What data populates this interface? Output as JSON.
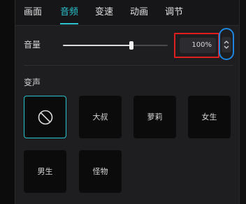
{
  "tabs": [
    {
      "label": "画面"
    },
    {
      "label": "音频",
      "active": true
    },
    {
      "label": "变速"
    },
    {
      "label": "动画"
    },
    {
      "label": "调节"
    }
  ],
  "volume": {
    "label": "音量",
    "value_text": "100%",
    "slider_fraction": 0.65
  },
  "voice_change": {
    "label": "变声",
    "selected": "none",
    "options": [
      {
        "id": "none",
        "label": "",
        "icon": "no-effect-icon"
      },
      {
        "id": "uncle",
        "label": "大叔"
      },
      {
        "id": "lolita",
        "label": "萝莉"
      },
      {
        "id": "female",
        "label": "女生"
      },
      {
        "id": "male",
        "label": "男生"
      },
      {
        "id": "monster",
        "label": "怪物"
      }
    ]
  },
  "colors": {
    "accent": "#2bc3cf",
    "highlight_red": "#e01e1e",
    "highlight_blue": "#1f86e0"
  }
}
